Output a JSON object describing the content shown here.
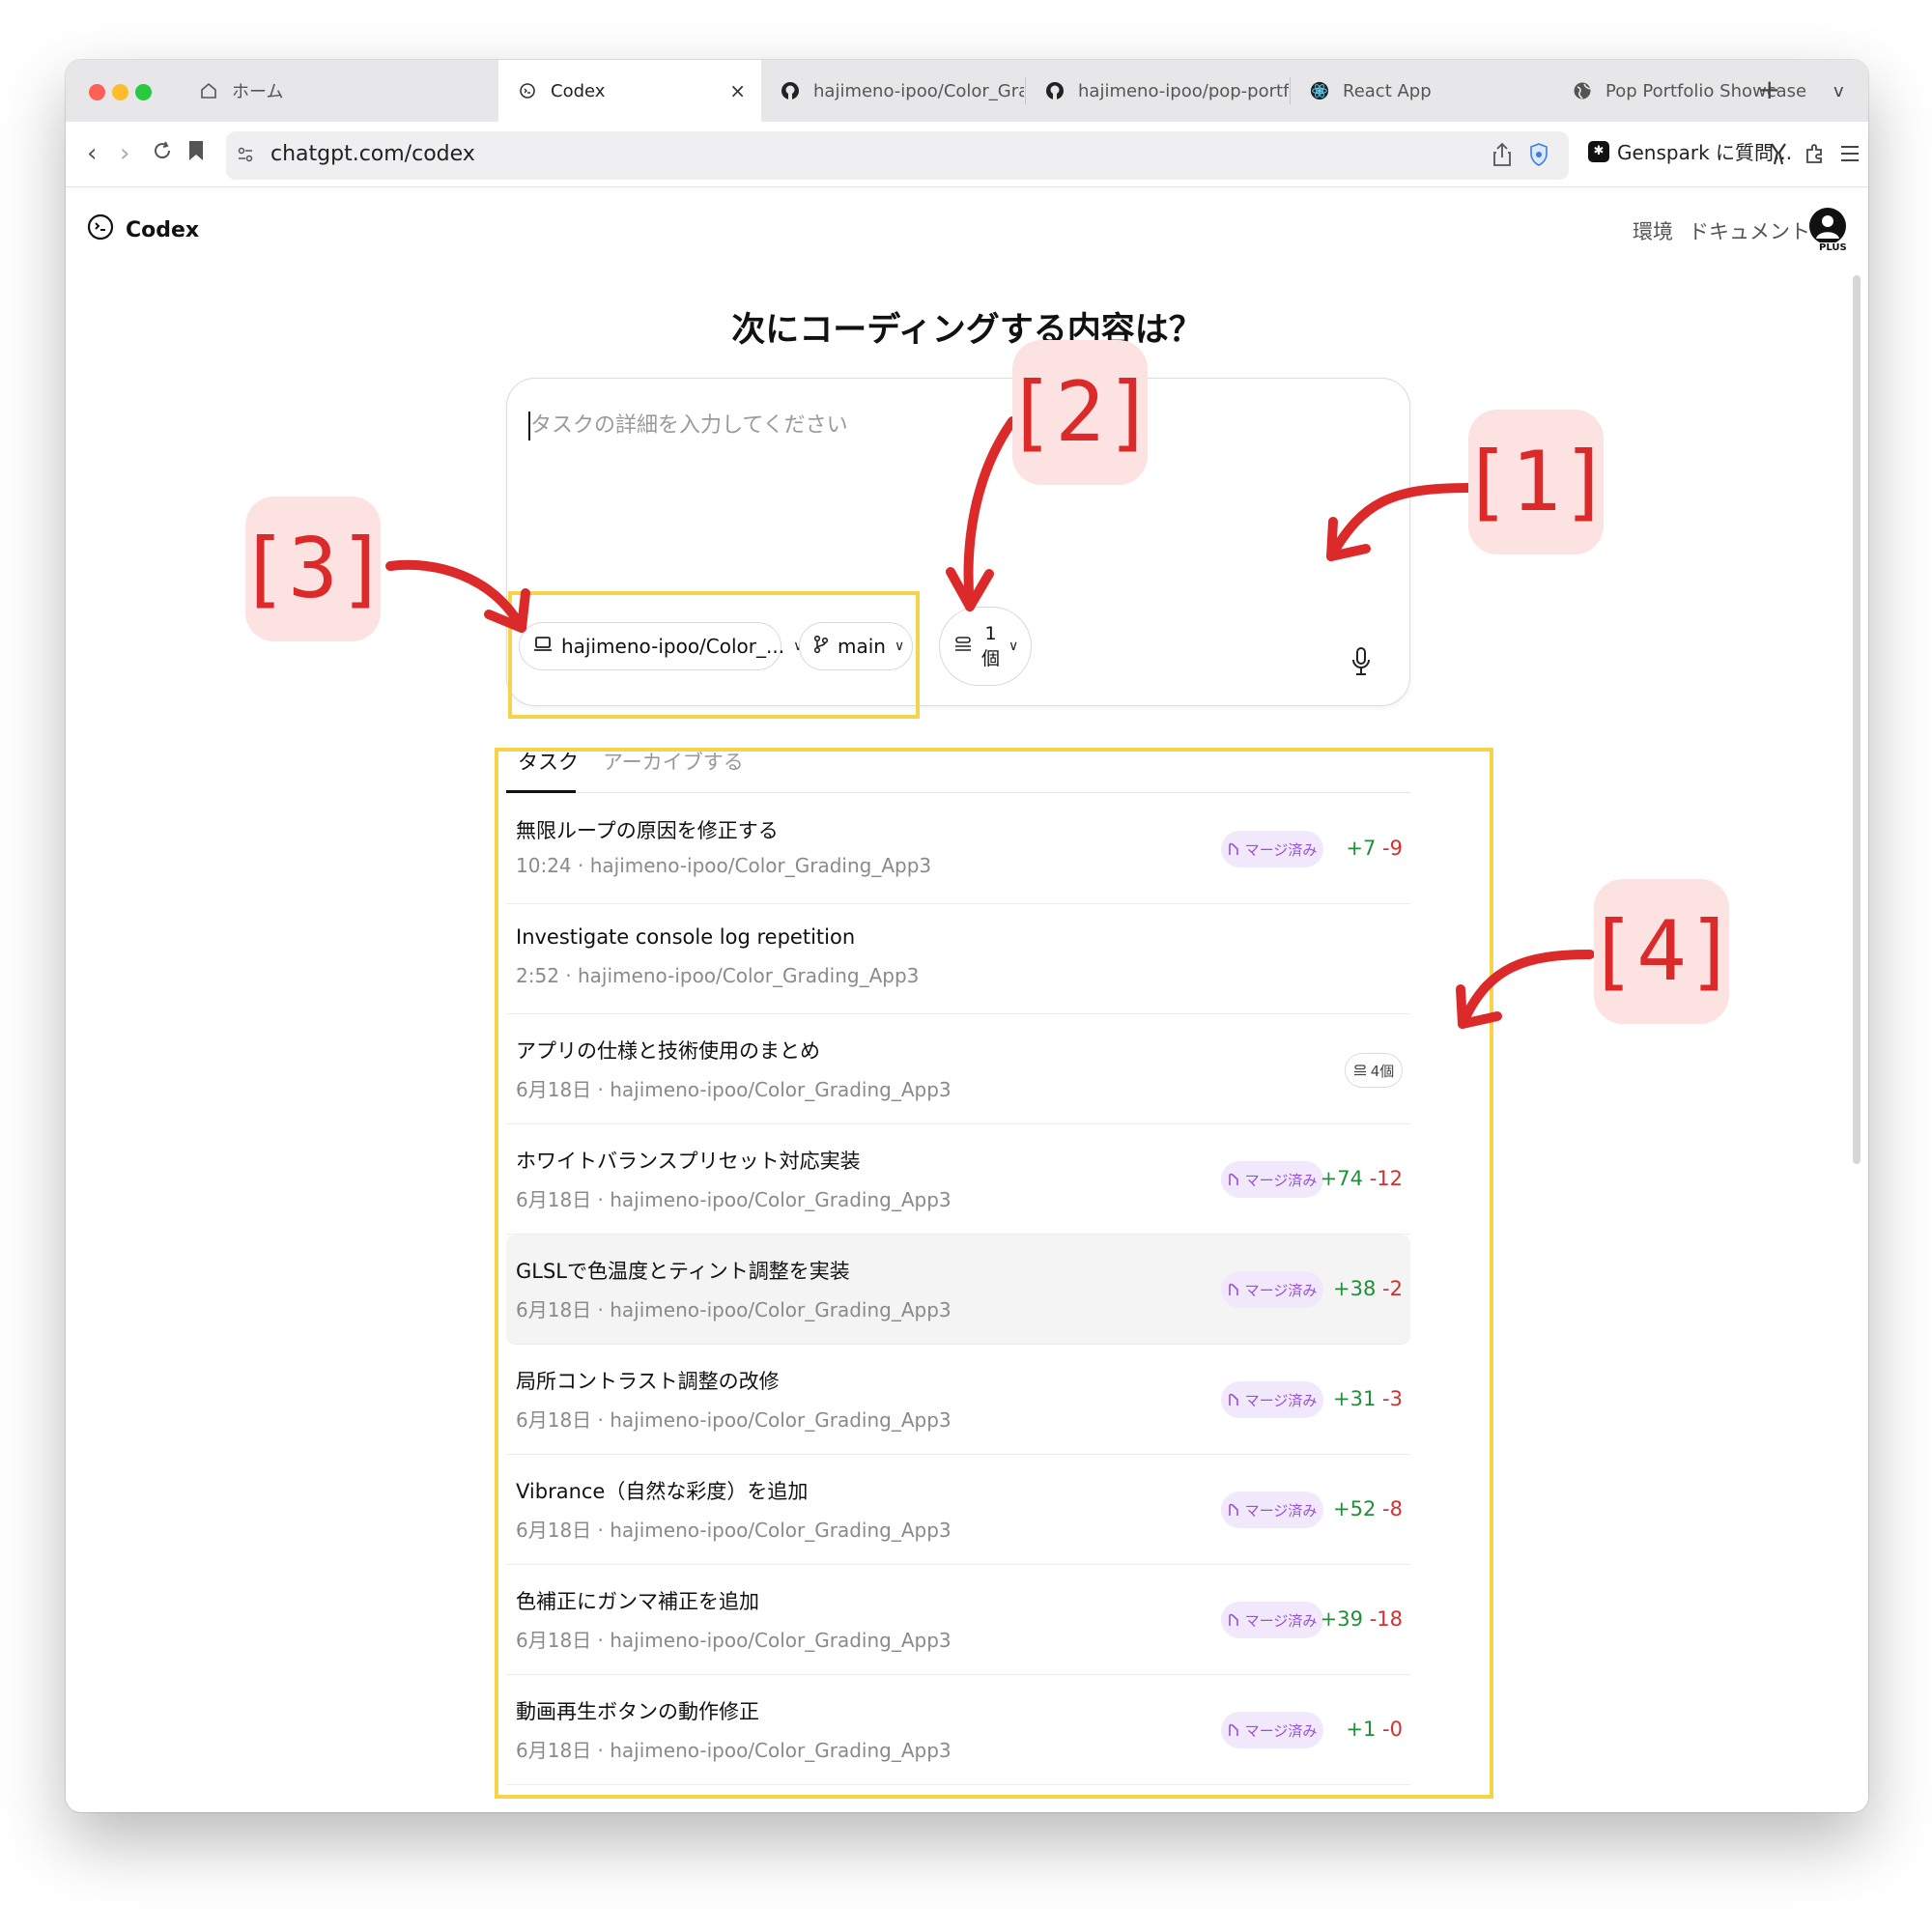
{
  "browser": {
    "tabs": [
      {
        "label": "ホーム",
        "icon": "home-icon"
      },
      {
        "label": "Codex",
        "icon": "codex-icon",
        "active": true,
        "close": "×"
      },
      {
        "label": "hajimeno-ipoo/Color_Grading_",
        "icon": "github-icon"
      },
      {
        "label": "hajimeno-ipoo/pop-portfolio-sh",
        "icon": "github-icon"
      },
      {
        "label": "React App",
        "icon": "react-icon"
      },
      {
        "label": "Pop Portfolio Showcase",
        "icon": "globe-icon"
      }
    ],
    "new_tab": "+",
    "tab_menu": "v",
    "url": "chatgpt.com/codex",
    "extension_label": "Genspark に質問..."
  },
  "header": {
    "brand": "Codex",
    "links": [
      "環境",
      "ドキュメント"
    ],
    "plan_badge": "PLUS"
  },
  "composer": {
    "title": "次にコーディングする内容は？",
    "placeholder": "タスクの詳細を入力してください",
    "repo_label": "hajimeno-ipoo/Color_...",
    "branch_label": "main",
    "count_number": "1",
    "count_unit": "個"
  },
  "tasks_tabs": {
    "tasks": "タスク",
    "archive": "アーカイブする"
  },
  "tasks": [
    {
      "title": "無限ループの原因を修正する",
      "meta": "10:24 · hajimeno-ipoo/Color_Grading_App3",
      "badge": "マージ済み",
      "add": "+7",
      "del": "-9"
    },
    {
      "title": "Investigate console log repetition",
      "meta": "2:52 · hajimeno-ipoo/Color_Grading_App3"
    },
    {
      "title": "アプリの仕様と技術使用のまとめ",
      "meta": "6月18日 · hajimeno-ipoo/Color_Grading_App3",
      "versions": "4個"
    },
    {
      "title": "ホワイトバランスプリセット対応実装",
      "meta": "6月18日 · hajimeno-ipoo/Color_Grading_App3",
      "badge": "マージ済み",
      "add": "+74",
      "del": "-12"
    },
    {
      "title": "GLSLで色温度とティント調整を実装",
      "meta": "6月18日 · hajimeno-ipoo/Color_Grading_App3",
      "badge": "マージ済み",
      "add": "+38",
      "del": "-2"
    },
    {
      "title": "局所コントラスト調整の改修",
      "meta": "6月18日 · hajimeno-ipoo/Color_Grading_App3",
      "badge": "マージ済み",
      "add": "+31",
      "del": "-3"
    },
    {
      "title": "Vibrance（自然な彩度）を追加",
      "meta": "6月18日 · hajimeno-ipoo/Color_Grading_App3",
      "badge": "マージ済み",
      "add": "+52",
      "del": "-8"
    },
    {
      "title": "色補正にガンマ補正を追加",
      "meta": "6月18日 · hajimeno-ipoo/Color_Grading_App3",
      "badge": "マージ済み",
      "add": "+39",
      "del": "-18"
    },
    {
      "title": "動画再生ボタンの動作修正",
      "meta": "6月18日 · hajimeno-ipoo/Color_Grading_App3",
      "badge": "マージ済み",
      "add": "+1",
      "del": "-0"
    }
  ],
  "annotations": {
    "callouts": [
      "[1]",
      "[2]",
      "[3]",
      "[4]"
    ],
    "highlight_color": "#f7d34a",
    "arrow_color": "#dc2a2a"
  }
}
